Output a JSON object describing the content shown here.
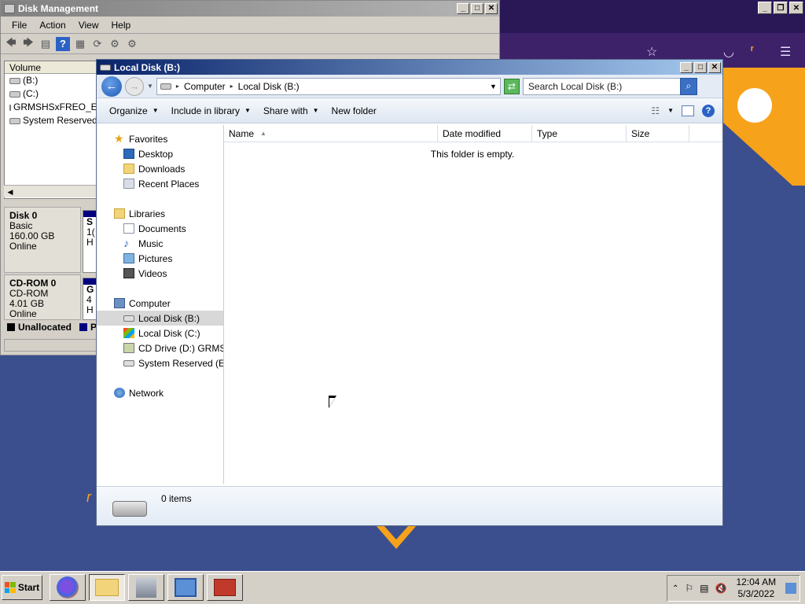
{
  "disk_management": {
    "title": "Disk Management",
    "menu": [
      "File",
      "Action",
      "View",
      "Help"
    ],
    "volume_header": "Volume",
    "volumes": [
      "(B:)",
      "(C:)",
      "GRMSHSxFREO_EN...",
      "System Reserved"
    ],
    "disks": [
      {
        "name": "Disk 0",
        "type": "Basic",
        "size": "160.00 GB",
        "status": "Online",
        "strip_top": "S",
        "strip_mid": "1(",
        "strip_bot": "H"
      },
      {
        "name": "CD-ROM 0",
        "type": "CD-ROM",
        "size": "4.01 GB",
        "status": "Online",
        "strip_top": "G",
        "strip_mid": "4",
        "strip_bot": "H"
      }
    ],
    "legend": [
      {
        "label": "Unallocated",
        "color": "#000000"
      },
      {
        "label": "P",
        "color": "#000080"
      }
    ]
  },
  "explorer": {
    "title": "Local Disk (B:)",
    "breadcrumb": [
      "Computer",
      "Local Disk (B:)"
    ],
    "search_placeholder": "Search Local Disk (B:)",
    "commands": [
      "Organize",
      "Include in library",
      "Share with",
      "New folder"
    ],
    "nav": {
      "favorites": "Favorites",
      "favorite_items": [
        "Desktop",
        "Downloads",
        "Recent Places"
      ],
      "libraries": "Libraries",
      "library_items": [
        "Documents",
        "Music",
        "Pictures",
        "Videos"
      ],
      "computer": "Computer",
      "computer_items": [
        "Local Disk (B:)",
        "Local Disk (C:)",
        "CD Drive (D:) GRMSHS",
        "System Reserved (E:)"
      ],
      "network": "Network"
    },
    "columns": [
      "Name",
      "Date modified",
      "Type",
      "Size"
    ],
    "empty_message": "This folder is empty.",
    "item_count": "0 items"
  },
  "taskbar": {
    "start_label": "Start",
    "time": "12:04 AM",
    "date": "5/3/2022"
  }
}
